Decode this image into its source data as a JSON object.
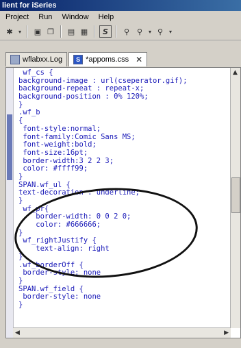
{
  "window": {
    "title": "lient for iSeries"
  },
  "menu": [
    "Project",
    "Run",
    "Window",
    "Help"
  ],
  "toolbar": {
    "icons": [
      "run-icon",
      "save-icon",
      "copy-icon",
      "print-icon",
      "save-all-icon",
      "s-icon",
      "search-icon",
      "replace-icon",
      "find-next-icon"
    ],
    "s_label": "S"
  },
  "tabs": [
    {
      "label": "wflabxx.Log",
      "active": false
    },
    {
      "label": "*appoms.css",
      "active": true
    }
  ],
  "code_lines": [
    " wf_cs {",
    "background-image : url(cseperator.gif);",
    "background-repeat : repeat-x;",
    "background-position : 0% 120%;",
    "}",
    ".wf_b",
    "{",
    " font-style:normal;",
    " font-family:Comic Sans MS;",
    " font-weight:bold;",
    " font-size:16pt;",
    " border-width:3 2 2 3;",
    " color: #ffff99;",
    "}",
    "SPAN.wf_ul {",
    "text-decoration : underline;",
    "}",
    " wf_pr{",
    "    border-width: 0 0 2 0;",
    "    color: #666666;",
    "}",
    " wf_rightJustify {",
    "    text-align: right",
    "}",
    ".wf_borderOff {",
    " border-style: none",
    "}",
    "SPAN.wf_field {",
    " border-style: none",
    "}"
  ]
}
